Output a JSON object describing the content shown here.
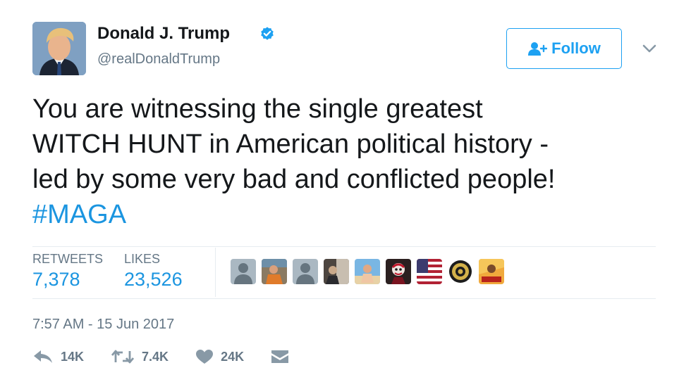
{
  "user": {
    "display_name": "Donald J. Trump",
    "handle": "@realDonaldTrump",
    "verified_icon": "verified-badge-icon"
  },
  "follow_button": {
    "label": "Follow",
    "icon": "add-user-icon"
  },
  "tweet": {
    "lines": [
      "You are witnessing the single greatest",
      "WITCH HUNT in American political history -",
      "led by some very bad and conflicted people!"
    ],
    "hashtag": "#MAGA"
  },
  "stats": {
    "retweets_label": "RETWEETS",
    "retweets_value": "7,378",
    "likes_label": "LIKES",
    "likes_value": "23,526"
  },
  "liker_avatars": [
    "default-avatar",
    "photo-avatar",
    "default-avatar",
    "photo-avatar",
    "photo-avatar",
    "photo-avatar",
    "flag-avatar",
    "seal-avatar",
    "poster-avatar"
  ],
  "timestamp": "7:57 AM - 15 Jun 2017",
  "actions": {
    "reply_count": "14K",
    "retweet_count": "7.4K",
    "like_count": "24K"
  },
  "colors": {
    "accent": "#1da1f2",
    "link": "#1b95e0",
    "secondary_text": "#657786",
    "primary_text": "#14171a",
    "divider": "#e6ecf0"
  }
}
